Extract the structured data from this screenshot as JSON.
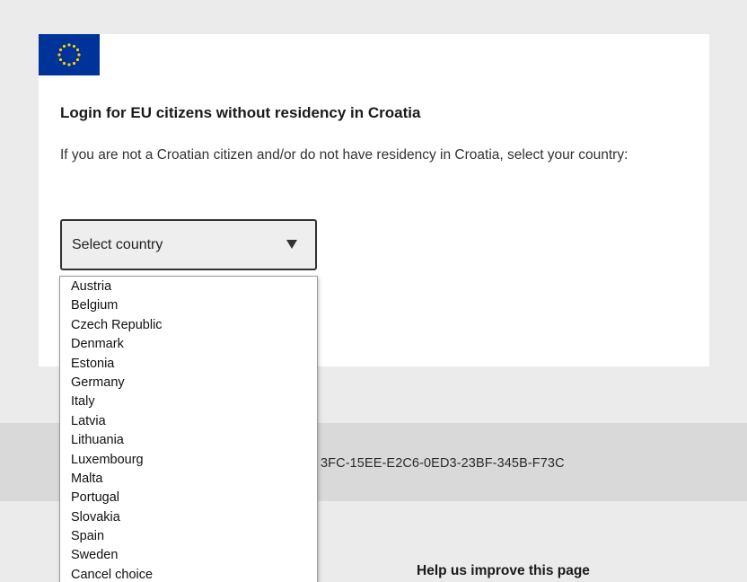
{
  "login": {
    "title": "Login for EU citizens without residency in Croatia",
    "description": "If you are not a Croatian citizen and/or do not have residency in Croatia, select your country:"
  },
  "flag": {
    "icon": "eu-flag-icon",
    "color": "#003399",
    "star_color": "#ffcc00"
  },
  "country_select": {
    "selected": "Select country",
    "options": [
      "Austria",
      "Belgium",
      "Czech Republic",
      "Denmark",
      "Estonia",
      "Germany",
      "Italy",
      "Latvia",
      "Lithuania",
      "Luxembourg",
      "Malta",
      "Portugal",
      "Slovakia",
      "Spain",
      "Sweden",
      "Cancel choice"
    ]
  },
  "session": {
    "id_visible": "3FC-15EE-E2C6-0ED3-23BF-345B-F73C"
  },
  "footer": {
    "help_title": "Help us improve this page"
  }
}
